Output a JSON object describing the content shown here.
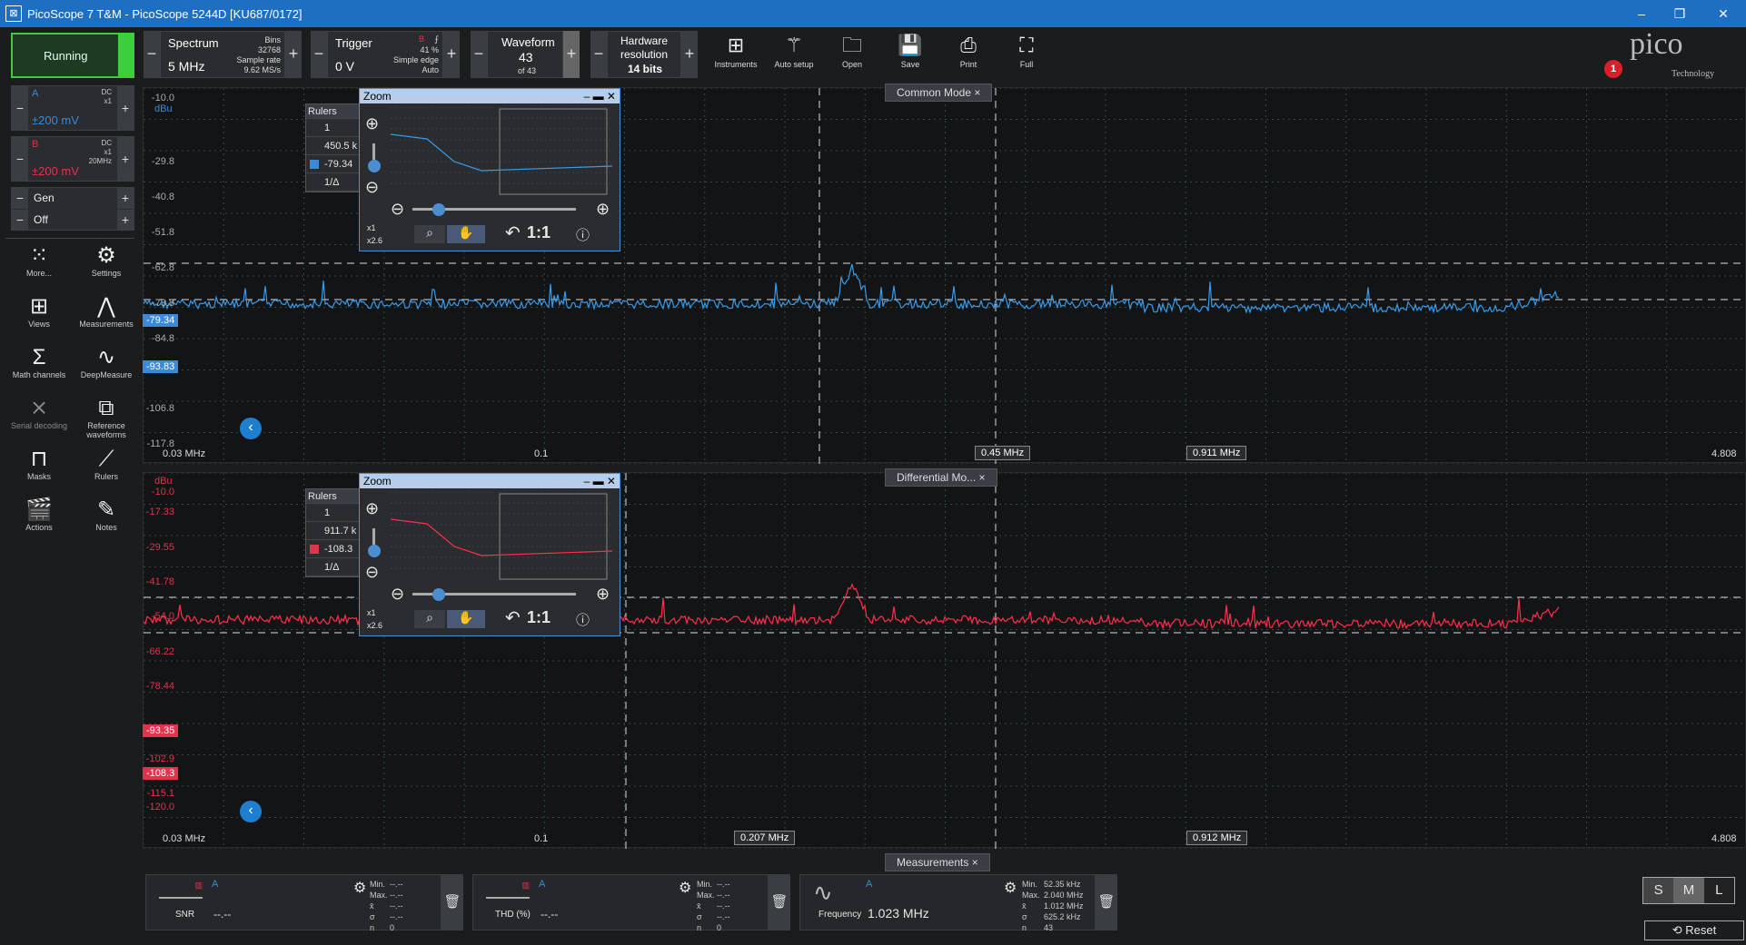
{
  "window": {
    "title": "PicoScope 7 T&M - PicoScope 5244D [KU687/0172]",
    "controls": [
      "–",
      "❐",
      "✕"
    ]
  },
  "toolbar": {
    "run_status": "Running",
    "spectrum": {
      "label": "Spectrum",
      "value": "5 MHz",
      "bins_label": "Bins",
      "bins": "32768",
      "rate_label": "Sample rate",
      "rate": "9.62 MS/s"
    },
    "trigger": {
      "label": "Trigger",
      "value": "0 V",
      "channel": "B",
      "percent": "41 %",
      "type": "Simple edge",
      "mode": "Auto"
    },
    "waveform": {
      "label": "Waveform",
      "value": "43",
      "of": "of 43"
    },
    "hardware": {
      "label1": "Hardware",
      "label2": "resolution",
      "value": "14 bits"
    },
    "tools": [
      {
        "name": "Instruments",
        "icon": "instruments-icon"
      },
      {
        "name": "Auto setup",
        "icon": "wand-icon"
      },
      {
        "name": "Open",
        "icon": "folder-icon"
      },
      {
        "name": "Save",
        "icon": "floppy-icon"
      },
      {
        "name": "Print",
        "icon": "printer-icon"
      },
      {
        "name": "Full",
        "icon": "fullscreen-icon"
      }
    ],
    "logo": "pico",
    "logo_sub": "Technology",
    "notification_count": "1"
  },
  "channels": [
    {
      "name": "A",
      "coupling": "DC",
      "probe": "x1",
      "range": "±200 mV",
      "color": "#3a8ad8"
    },
    {
      "name": "B",
      "coupling": "DC",
      "probe": "x1",
      "bw": "20MHz",
      "range": "±200 mV",
      "color": "#e0344d"
    }
  ],
  "generator": {
    "label": "Gen",
    "state": "Off"
  },
  "left_tools": [
    {
      "label": "More...",
      "icon": "grid-dots-icon"
    },
    {
      "label": "Settings",
      "icon": "gear-icon"
    },
    {
      "label": "Views",
      "icon": "views-icon"
    },
    {
      "label": "Measurements",
      "icon": "caliper-icon"
    },
    {
      "label": "Math channels",
      "icon": "sigma-icon"
    },
    {
      "label": "DeepMeasure",
      "icon": "deepmeasure-icon"
    },
    {
      "label": "Serial decoding",
      "icon": "serial-icon"
    },
    {
      "label": "Reference waveforms",
      "icon": "reference-icon"
    },
    {
      "label": "Masks",
      "icon": "mask-icon"
    },
    {
      "label": "Rulers",
      "icon": "ruler-icon"
    },
    {
      "label": "Actions",
      "icon": "clapper-icon"
    },
    {
      "label": "Notes",
      "icon": "notes-icon"
    }
  ],
  "plot_top": {
    "tab": "Common Mode",
    "unit": "dBu",
    "y_ticks": [
      "-10.0",
      "-29.8",
      "-40.8",
      "-51.8",
      "-62.8",
      "-73.8",
      "-84.8",
      "-106.8",
      "-117.8"
    ],
    "ruler_labels": [
      "-79.34",
      "-93.83"
    ],
    "x_start": "0.03 MHz",
    "x_mid": "0.1",
    "x_end": "4.808",
    "markers": [
      "0.45 MHz",
      "0.911 MHz"
    ],
    "rulers_table": {
      "title": "Rulers",
      "rows": [
        "1",
        "450.5 k",
        "-79.34",
        "1/Δ"
      ]
    }
  },
  "plot_bottom": {
    "tab": "Differential Mo...",
    "unit": "dBu",
    "y_ticks": [
      "-10.0",
      "-17.33",
      "-29.55",
      "-41.78",
      "-54.0",
      "-66.22",
      "-78.44",
      "-102.9",
      "-115.1",
      "-120.0"
    ],
    "ruler_labels": [
      "-93.35",
      "-108.3"
    ],
    "x_start": "0.03 MHz",
    "x_mid": "0.1",
    "x_end": "4.808",
    "markers": [
      "0.207 MHz",
      "0.912 MHz"
    ],
    "rulers_table": {
      "title": "Rulers",
      "rows": [
        "1",
        "911.7 k",
        "-108.3",
        "1/Δ"
      ]
    }
  },
  "zoom": {
    "title": "Zoom",
    "scale1": "x1",
    "scale2": "x2.6",
    "ratio": "1:1"
  },
  "measurements_tab": "Measurements",
  "measurements": [
    {
      "name": "SNR",
      "channel": "A",
      "value": "--.--",
      "min": "--.--",
      "max": "--.--",
      "mean": "--.--",
      "sigma": "--.--",
      "n": "0"
    },
    {
      "name": "THD (%)",
      "channel": "A",
      "value": "--.--",
      "min": "--.--",
      "max": "--.--",
      "mean": "--.--",
      "sigma": "--.--",
      "n": "0"
    },
    {
      "name": "Frequency",
      "channel": "A",
      "value": "1.023 MHz",
      "min": "52.35 kHz",
      "max": "2.040 MHz",
      "mean": "1.012 MHz",
      "sigma": "625.2 kHz",
      "n": "43"
    }
  ],
  "stat_labels": {
    "min": "Min.",
    "max": "Max.",
    "mean": "x̄",
    "sigma": "σ",
    "n": "n"
  },
  "size_buttons": [
    "S",
    "M",
    "L"
  ],
  "reset_label": "Reset"
}
